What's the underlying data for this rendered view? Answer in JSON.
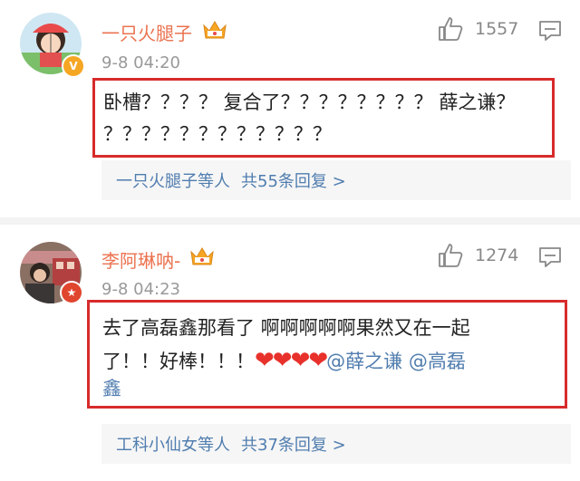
{
  "comments": [
    {
      "username": "一只火腿子",
      "time": "9-8 04:20",
      "likes": "1557",
      "text_lines": [
        "卧槽？？？？ 复合了？？？？？？？？ 薛之谦？",
        "？？？？？？？？？？？？"
      ],
      "reply": {
        "names": "一只火腿子等人",
        "count": "共55条回复 >"
      },
      "avatar_icon": "chibi-maruko-avatar",
      "badge": "V"
    },
    {
      "username": "李阿琳呐-",
      "time": "9-8 04:23",
      "likes": "1274",
      "text_line1": "去了高磊鑫那看了 啊啊啊啊啊果然又在一起",
      "text_line2_prefix": "了！！好棒！！！",
      "hearts": "❤❤❤❤",
      "mention1": "@薛之谦",
      "mention2": "@高磊",
      "text_line3": "鑫",
      "reply": {
        "names": "工科小仙女等人",
        "count": "共37条回复 >"
      },
      "avatar_icon": "photo-avatar",
      "badge": "★"
    }
  ],
  "colors": {
    "username": "#eb7350",
    "highlight_border": "#d72b2b",
    "link": "#507daf"
  }
}
